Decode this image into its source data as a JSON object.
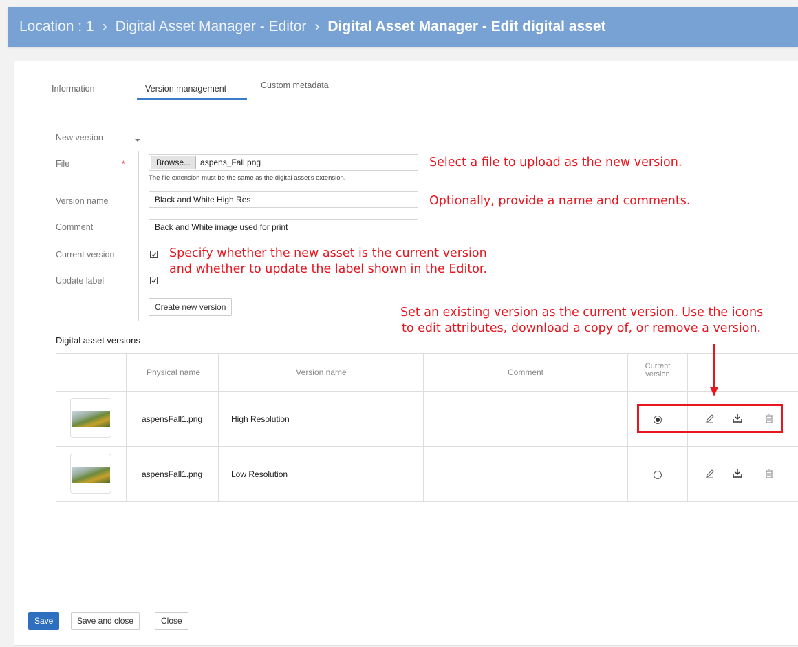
{
  "breadcrumb": {
    "location": "Location : 1",
    "editor": "Digital Asset Manager - Editor",
    "current": "Digital Asset Manager - Edit digital asset"
  },
  "tabs": [
    "Information",
    "Version management",
    "Custom metadata"
  ],
  "active_tab": "Version management",
  "form": {
    "new_version_label": "New version",
    "file_label": "File",
    "browse_label": "Browse...",
    "file_value": "aspens_Fall.png",
    "file_hint": "The file extension must be the same as the digital asset's extension.",
    "version_name_label": "Version name",
    "version_name_value": "Black and White High Res",
    "comment_label": "Comment",
    "comment_value": "Back and White image used for print",
    "current_version_label": "Current version",
    "update_label_label": "Update label",
    "create_button": "Create new version"
  },
  "annotations": {
    "file": "Select a file to upload as the new version.",
    "name": "Optionally, provide a name and comments.",
    "checks_line1": "Specify whether the new asset is the current version",
    "checks_line2": "and whether to update the label shown in the Editor.",
    "table_line1": "Set an existing version as the current version. Use the icons",
    "table_line2": "to edit attributes, download a copy of, or remove a version."
  },
  "versions_section": {
    "title": "Digital asset versions",
    "columns": {
      "physical_name": "Physical name",
      "version_name": "Version name",
      "comment": "Comment",
      "current_line1": "Current",
      "current_line2": "version"
    },
    "rows": [
      {
        "physical_name": "aspensFall1.png",
        "version_name": "High Resolution",
        "comment": "",
        "current": true
      },
      {
        "physical_name": "aspensFall1.png",
        "version_name": "Low Resolution",
        "comment": "",
        "current": false
      }
    ]
  },
  "footer": {
    "save": "Save",
    "save_and_close": "Save and close",
    "close": "Close"
  },
  "colors": {
    "header_bg": "#79a2d4",
    "accent": "#2f6fc0",
    "annotation": "#e8171f"
  }
}
